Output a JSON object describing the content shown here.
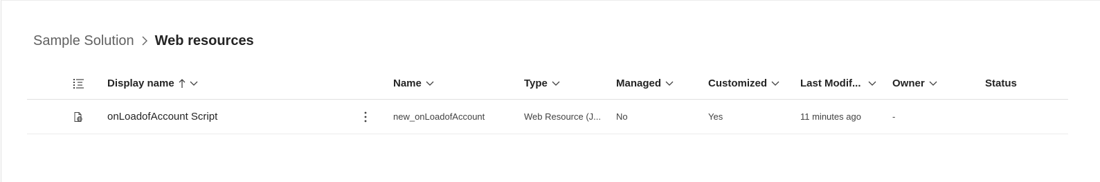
{
  "breadcrumb": {
    "parent": "Sample Solution",
    "current": "Web resources"
  },
  "table": {
    "columns": [
      {
        "key": "display_name",
        "label": "Display name",
        "sorted": "asc"
      },
      {
        "key": "name",
        "label": "Name"
      },
      {
        "key": "type",
        "label": "Type"
      },
      {
        "key": "managed",
        "label": "Managed"
      },
      {
        "key": "customized",
        "label": "Customized"
      },
      {
        "key": "last_modified",
        "label": "Last Modif..."
      },
      {
        "key": "owner",
        "label": "Owner"
      },
      {
        "key": "status",
        "label": "Status"
      }
    ],
    "rows": [
      {
        "icon": "web-resource-icon",
        "display_name": "onLoadofAccount Script",
        "name": "new_onLoadofAccount",
        "type": "Web Resource (J...",
        "managed": "No",
        "customized": "Yes",
        "last_modified": "11 minutes ago",
        "owner": "-",
        "status": ""
      }
    ]
  }
}
